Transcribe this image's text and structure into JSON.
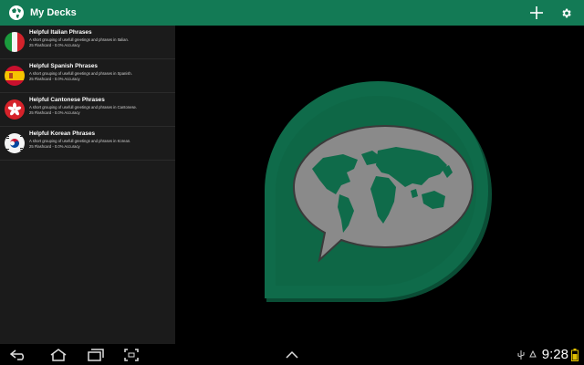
{
  "app": {
    "title": "My Decks"
  },
  "decks": [
    {
      "title": "Helpful Italian Phrases",
      "description": "A short grouping of usefull greetings and phrases in Italian.",
      "stats": "25 Flashcard - 0.0% Accuracy",
      "flag": "italy-flag-icon"
    },
    {
      "title": "Helpful Spanish Phrases",
      "description": "A short grouping of usefull greetings and phrases in Spanish.",
      "stats": "25 Flashcard - 0.0% Accuracy",
      "flag": "spain-flag-icon"
    },
    {
      "title": "Helpful Cantonese Phrases",
      "description": "A short grouping of usefull greetings and phrases in Cantonese.",
      "stats": "25 Flashcard - 0.0% Accuracy",
      "flag": "hong-kong-flag-icon"
    },
    {
      "title": "Helpful Korean Phrases",
      "description": "A short grouping of usefull greetings and phrases in Korean.",
      "stats": "25 Flashcard - 0.0% Accuracy",
      "flag": "south-korea-flag-icon"
    }
  ],
  "status": {
    "time": "9:28"
  },
  "colors": {
    "action_bar": "#137a55",
    "logo_green": "#0f6b4a",
    "logo_bubble": "#8a8a8a"
  }
}
